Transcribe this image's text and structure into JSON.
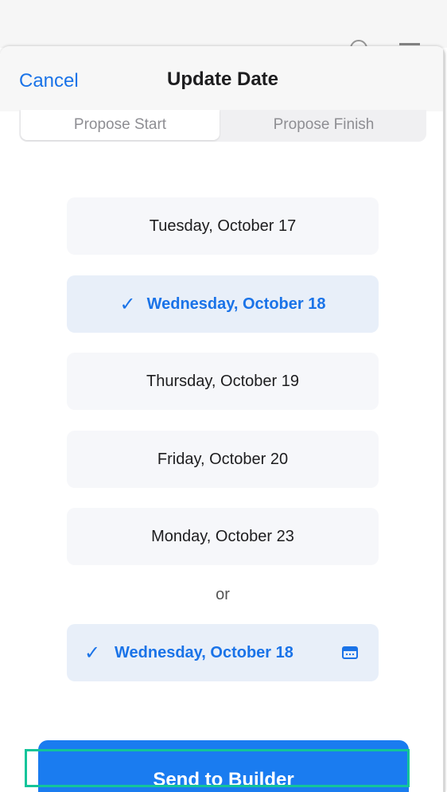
{
  "nav": {
    "cancel_label": "Cancel",
    "title": "Update Date"
  },
  "segments": {
    "start_label": "Propose Start",
    "finish_label": "Propose Finish",
    "active": "start"
  },
  "dates": [
    {
      "label": "Tuesday, October 17",
      "selected": false
    },
    {
      "label": "Wednesday, October 18",
      "selected": true
    },
    {
      "label": "Thursday, October 19",
      "selected": false
    },
    {
      "label": "Friday, October 20",
      "selected": false
    },
    {
      "label": "Monday, October 23",
      "selected": false
    }
  ],
  "separator": "or",
  "custom_date": {
    "label": "Wednesday, October 18",
    "selected": true,
    "icon": "calendar-icon"
  },
  "action": {
    "send_label": "Send to Builder"
  },
  "colors": {
    "accent": "#1a73e8",
    "highlight": "#13c49a"
  }
}
